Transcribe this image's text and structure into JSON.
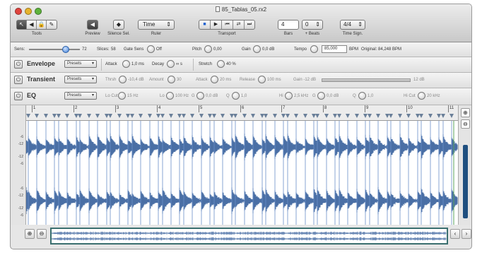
{
  "window": {
    "title": "85_Tablas_05.rx2"
  },
  "toolbar": {
    "tools_label": "Tools",
    "preview_label": "Preview",
    "silence_label": "Silence Sel.",
    "ruler_label": "Ruler",
    "ruler_value": "Time",
    "transport_label": "Transport",
    "bars_label": "Bars",
    "bars_value": "4",
    "beats_label": "+ Beats",
    "beats_value": "0",
    "timesig_label": "Time Sign.",
    "timesig_value": "4/4"
  },
  "slice_row": {
    "sens_label": "Sens:",
    "sens_value": "72",
    "sens_level": 0.72,
    "slices_label": "Slices:",
    "slices_value": "58",
    "gate_label": "Gate Sens",
    "gate_value": "Off",
    "pitch_label": "Pitch",
    "pitch_value": "0,00",
    "gain_label": "Gain",
    "gain_value": "0,0 dB",
    "tempo_label": "Tempo",
    "tempo_value": "85,000",
    "bpm_label": "BPM",
    "original_label": "Original: 84,248 BPM"
  },
  "envelope": {
    "title": "Envelope",
    "presets": "Presets",
    "attack_label": "Attack",
    "attack_value": "1,0 ms",
    "decay_label": "Decay",
    "decay_value": "∞ s",
    "stretch_label": "Stretch",
    "stretch_value": "40 %"
  },
  "transient": {
    "title": "Transient",
    "presets": "Presets",
    "thresh_label": "Thrsh",
    "thresh_value": "-10,4 dB",
    "amount_label": "Amount",
    "amount_value": "30",
    "attack_label": "Attack",
    "attack_value": "20 ms",
    "release_label": "Release",
    "release_value": "100 ms",
    "gain_label": "Gain -12 dB",
    "gain_right": "12 dB"
  },
  "eq": {
    "title": "EQ",
    "presets": "Presets",
    "locut_label": "Lo Cut",
    "locut_value": "15 Hz",
    "lo_label": "Lo",
    "lo_value": "100 Hz",
    "lo_g_label": "G",
    "lo_g_value": "0,0 dB",
    "lo_q_label": "Q",
    "lo_q_value": "1,0",
    "hi_label": "Hi",
    "hi_value": "2,5 kHz",
    "hi_g_label": "G",
    "hi_g_value": "0,0 dB",
    "hi_q_label": "Q",
    "hi_q_value": "1,0",
    "hicut_label": "Hi Cut",
    "hicut_value": "20 kHz"
  },
  "ruler": {
    "bars": [
      "1",
      "2",
      "3",
      "4",
      "5",
      "6",
      "7",
      "8",
      "9",
      "10",
      "11"
    ]
  },
  "db_scale": [
    "-6",
    "-12",
    "-12",
    "-6",
    "-6",
    "-12",
    "-12",
    "-6"
  ],
  "colors": {
    "wave": "#4a6fa5",
    "slice": "#6a8fc8",
    "overview_border": "#3a6f6f"
  }
}
